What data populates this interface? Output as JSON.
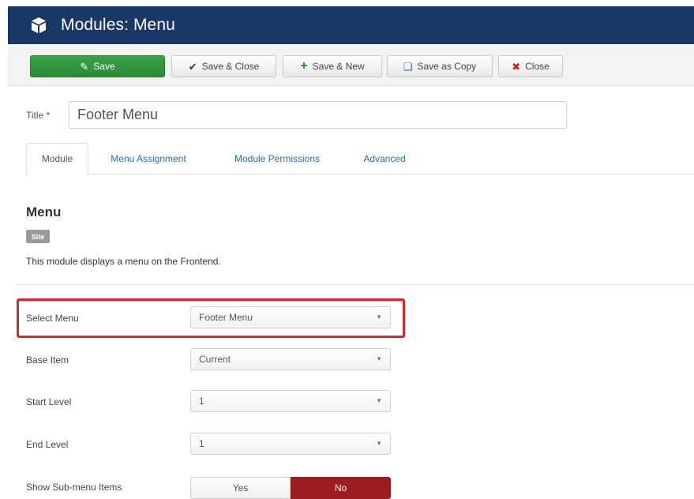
{
  "header": {
    "title": "Modules: Menu",
    "icon": "cube-icon",
    "bg_color": "#1a3867"
  },
  "toolbar": {
    "save_label": "Save",
    "save_close_label": "Save & Close",
    "save_new_label": "Save & New",
    "save_copy_label": "Save as Copy",
    "close_label": "Close"
  },
  "form": {
    "title_label": "Title *",
    "title_value": "Footer Menu"
  },
  "tabs": [
    "Module",
    "Menu Assignment",
    "Module Permissions",
    "Advanced"
  ],
  "module": {
    "name": "Menu",
    "badge": "Site",
    "description": "This module displays a menu on the Frontend."
  },
  "fields": {
    "select_menu": {
      "label": "Select Menu",
      "value": "Footer Menu"
    },
    "base_item": {
      "label": "Base Item",
      "value": "Current"
    },
    "start_level": {
      "label": "Start Level",
      "value": "1"
    },
    "end_level": {
      "label": "End Level",
      "value": "1"
    },
    "show_submenu": {
      "label": "Show Sub-menu Items",
      "yes": "Yes",
      "no": "No",
      "selected": "No"
    }
  },
  "colors": {
    "save_green": "#2f9a3e",
    "no_active": "#9b1d20",
    "highlight_red": "#d9262b"
  }
}
